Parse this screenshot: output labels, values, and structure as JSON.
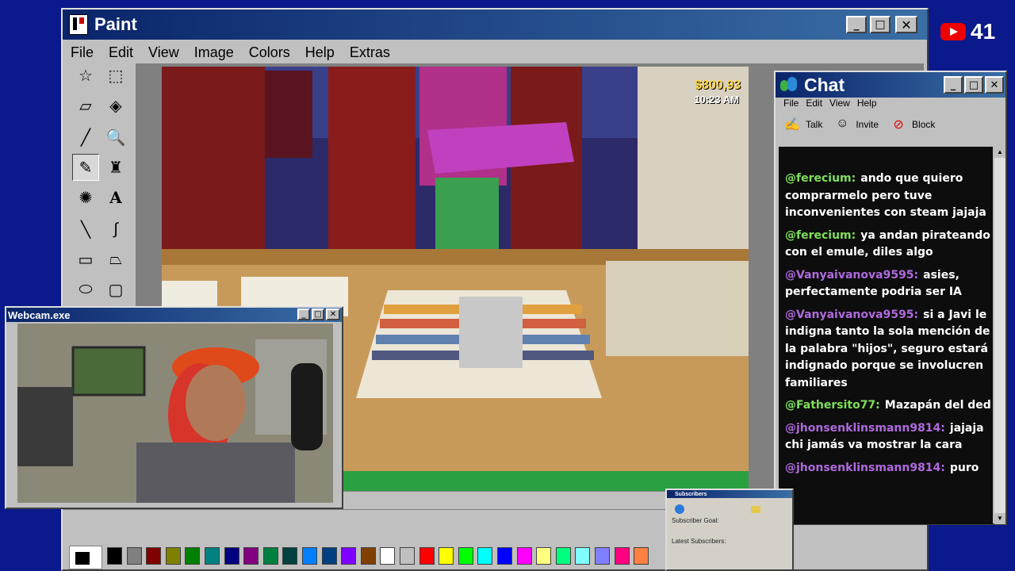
{
  "paint": {
    "title": "Paint",
    "menu": [
      "File",
      "Edit",
      "View",
      "Image",
      "Colors",
      "Help",
      "Extras"
    ],
    "tools": [
      "free-select-icon",
      "rect-select-icon",
      "eraser-icon",
      "fill-icon",
      "eyedropper-icon",
      "magnifier-icon",
      "pencil-icon",
      "brush-icon",
      "airbrush-icon",
      "text-icon",
      "line-icon",
      "curve-icon",
      "rectangle-icon",
      "polygon-icon",
      "ellipse-icon",
      "rounded-rect-icon"
    ],
    "palette": [
      "#000000",
      "#808080",
      "#800000",
      "#808000",
      "#008000",
      "#008080",
      "#000080",
      "#800080",
      "#008040",
      "#004040",
      "#0080ff",
      "#004080",
      "#8000ff",
      "#804000",
      "#ffffff",
      "#c0c0c0",
      "#ff0000",
      "#ffff00",
      "#00ff00",
      "#00ffff",
      "#0000ff",
      "#ff00ff",
      "#ffff80",
      "#00ff80",
      "#80ffff",
      "#8080ff",
      "#ff0080",
      "#ff8040"
    ]
  },
  "game_hud": {
    "money": "$800,93",
    "time": "10:23 AM"
  },
  "youtube": {
    "count": "41"
  },
  "webcam": {
    "title": "Webcam.exe"
  },
  "subscribers": {
    "title": "Subscribers",
    "goal_label": "Subscriber Goal:",
    "latest_label": "Latest Subscribers:"
  },
  "chat": {
    "title": "Chat",
    "menu": [
      "File",
      "Edit",
      "View",
      "Help"
    ],
    "tools": [
      {
        "label": "Talk",
        "icon": "talk-icon"
      },
      {
        "label": "Invite",
        "icon": "invite-icon"
      },
      {
        "label": "Block",
        "icon": "block-icon"
      }
    ],
    "messages": [
      {
        "user": "@ferecium:",
        "text": "ando que quiero comprarmelo pero tuve inconvenientes con steam jajaja",
        "color": "#7ee05a"
      },
      {
        "user": "@ferecium:",
        "text": "ya andan pirateando con el emule, diles algo",
        "color": "#7ee05a"
      },
      {
        "user": "@Vanyaivanova9595:",
        "text": "asies, perfectamente podria ser IA",
        "color": "#b06adf"
      },
      {
        "user": "@Vanyaivanova9595:",
        "text": "si a Javi le indigna tanto la sola mención de la palabra \"hijos\", seguro estará indignado porque se involucren familiares",
        "color": "#b06adf"
      },
      {
        "user": "@Fathersito77:",
        "text": "Mazapán del ded",
        "color": "#7ee05a"
      },
      {
        "user": "@jhonsenklinsmann9814:",
        "text": "jajaja chi jamás va mostrar la cara",
        "color": "#b06adf"
      },
      {
        "user": "@jhonsenklinsmann9814:",
        "text": "puro",
        "color": "#b06adf"
      }
    ]
  }
}
